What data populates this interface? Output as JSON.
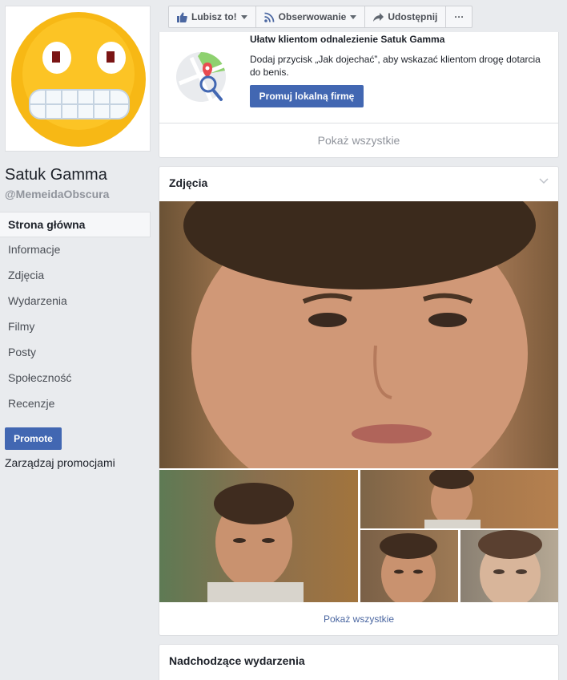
{
  "page": {
    "name": "Satuk Gamma",
    "handle": "@MemeidaObscura"
  },
  "nav": {
    "items": [
      {
        "label": "Strona główna",
        "active": true
      },
      {
        "label": "Informacje"
      },
      {
        "label": "Zdjęcia"
      },
      {
        "label": "Wydarzenia"
      },
      {
        "label": "Filmy"
      },
      {
        "label": "Posty"
      },
      {
        "label": "Społeczność"
      },
      {
        "label": "Recenzje"
      }
    ],
    "promote_label": "Promote",
    "manage_label": "Zarządzaj promocjami"
  },
  "actions": {
    "like_label": "Lubisz to!",
    "follow_label": "Obserwowanie",
    "share_label": "Udostępnij",
    "more_label": "···"
  },
  "promo": {
    "title": "Ułatw klientom odnalezienie Satuk Gamma",
    "text": "Dodaj przycisk „Jak dojechać”, aby wskazać klientom drogę dotarcia do benis.",
    "button_label": "Promuj lokalną firmę",
    "show_all": "Pokaż wszystkie"
  },
  "photos": {
    "title": "Zdjęcia",
    "show_all": "Pokaż wszystkie"
  },
  "events": {
    "title": "Nadchodzące wydarzenia"
  },
  "colors": {
    "brand": "#4267b2",
    "background": "#e9ebee"
  }
}
